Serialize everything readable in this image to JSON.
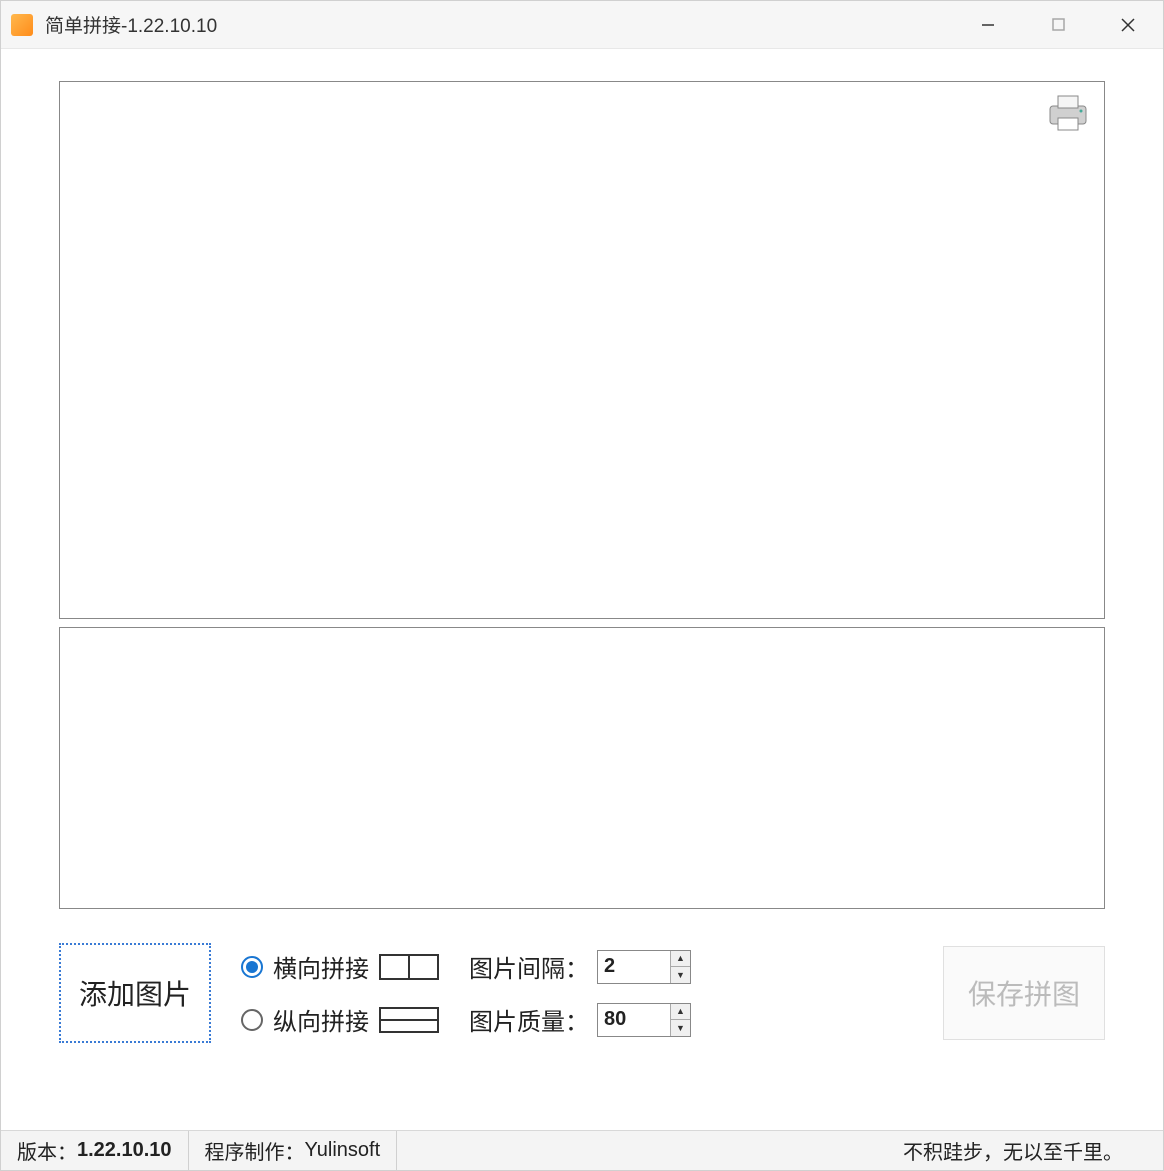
{
  "window": {
    "title": "简单拼接-1.22.10.10"
  },
  "controls": {
    "add_image_label": "添加图片",
    "horizontal_label": "横向拼接",
    "vertical_label": "纵向拼接",
    "gap_label": "图片间隔：",
    "gap_value": "2",
    "quality_label": "图片质量：",
    "quality_value": "80",
    "save_label": "保存拼图"
  },
  "status": {
    "version_label": "版本：",
    "version_value": "1.22.10.10",
    "author_label": "程序制作：",
    "author_value": "Yulinsoft",
    "motto": "不积跬步，无以至千里。"
  }
}
